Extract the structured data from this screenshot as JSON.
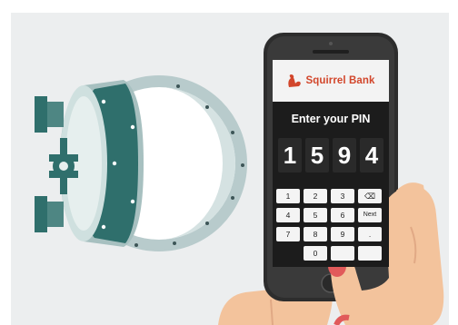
{
  "app": {
    "brand_name": "Squirrel Bank",
    "brand_icon": "squirrel-icon",
    "brand_color": "#d2462b"
  },
  "pin_screen": {
    "title": "Enter your PIN",
    "digits": [
      "1",
      "5",
      "9",
      "4"
    ]
  },
  "keypad": {
    "keys": [
      {
        "label": "1",
        "name": "key-1"
      },
      {
        "label": "2",
        "name": "key-2"
      },
      {
        "label": "3",
        "name": "key-3"
      },
      {
        "label": "⌫",
        "name": "key-backspace-icon"
      },
      {
        "label": "4",
        "name": "key-4"
      },
      {
        "label": "5",
        "name": "key-5"
      },
      {
        "label": "6",
        "name": "key-6"
      },
      {
        "label": "Next",
        "name": "key-next"
      },
      {
        "label": "7",
        "name": "key-7"
      },
      {
        "label": "8",
        "name": "key-8"
      },
      {
        "label": "9",
        "name": "key-9"
      },
      {
        "label": ".",
        "name": "key-dot"
      },
      {
        "label": "",
        "name": "key-blank-left"
      },
      {
        "label": "0",
        "name": "key-0"
      },
      {
        "label": "",
        "name": "key-blank-right"
      },
      {
        "label": "",
        "name": "key-blank-end"
      }
    ]
  },
  "colors": {
    "background": "#eceeef",
    "vault_teal": "#2f6f6c",
    "vault_light": "#b9cfcd",
    "phone_body": "#2d2d2d",
    "screen_bg": "#1c1c1c",
    "skin": "#f3c39c",
    "nail": "#e15a5a"
  }
}
